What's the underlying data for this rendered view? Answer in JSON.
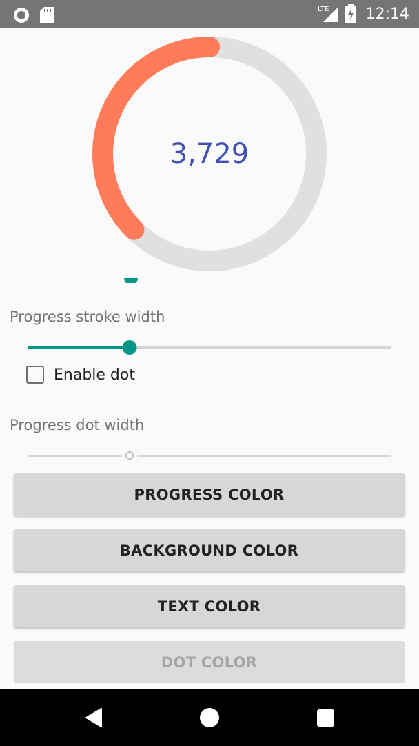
{
  "status_bar": {
    "time": "12:14",
    "network": "LTE",
    "icons": [
      "record-icon",
      "sd-card-icon",
      "lte-signal-icon",
      "battery-charging-icon"
    ]
  },
  "progress": {
    "value_text": "3,729",
    "progress_fraction": 0.375,
    "progress_color": "#ff7b5a",
    "background_color": "#e0e0e0",
    "text_color": "#3f51b5"
  },
  "controls": {
    "stroke_width_label": "Progress stroke width",
    "stroke_width_fraction": 0.28,
    "enable_dot_label": "Enable dot",
    "enable_dot_checked": false,
    "dot_width_label": "Progress dot width",
    "dot_width_fraction": 0.28,
    "accent_color": "#009688"
  },
  "buttons": {
    "progress_color": "PROGRESS COLOR",
    "background_color": "BACKGROUND COLOR",
    "text_color": "TEXT COLOR",
    "dot_color": "DOT COLOR"
  },
  "nav": {
    "icons": [
      "back-icon",
      "home-icon",
      "recents-icon"
    ]
  }
}
